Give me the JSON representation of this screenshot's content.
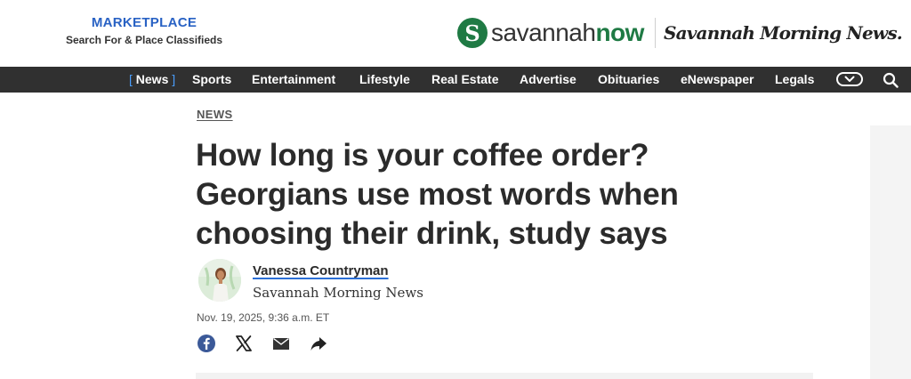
{
  "marketplace": {
    "title": "MARKETPLACE",
    "subtitle": "Search For & Place Classifieds"
  },
  "brand": {
    "badge_letter": "S",
    "word_plain": "savannah",
    "word_bold": "now",
    "paper_name": "Savannah Morning News.",
    "brand_green": "#1f7a44"
  },
  "nav": {
    "items": [
      {
        "label": "News",
        "active": true
      },
      {
        "label": "Sports"
      },
      {
        "label": "Entertainment"
      },
      {
        "label": "Lifestyle"
      },
      {
        "label": "Real Estate"
      },
      {
        "label": "Advertise"
      },
      {
        "label": "Obituaries"
      },
      {
        "label": "eNewspaper"
      },
      {
        "label": "Legals"
      }
    ],
    "active_bracket_open": "[",
    "active_bracket_close": "]",
    "more_icon": "chevron-down-icon",
    "search_icon": "search-icon",
    "bar_color": "#303030",
    "accent_color": "#4a9eff"
  },
  "article": {
    "section": "NEWS",
    "headline_line1": "How long is your coffee order?",
    "headline_line2": "Georgians use most words when",
    "headline_line3": "choosing their drink, study says",
    "author": "Vanessa Countryman",
    "publication": "Savannah Morning News",
    "timestamp": "Nov. 19, 2025, 9:36 a.m. ET"
  },
  "share": {
    "icons": [
      "facebook-icon",
      "x-icon",
      "email-icon",
      "share-icon"
    ]
  }
}
